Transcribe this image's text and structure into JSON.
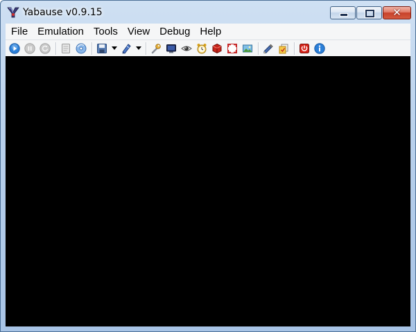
{
  "window": {
    "title": "Yabause v0.9.15",
    "app_icon": "yabause-logo-icon",
    "caption_buttons": [
      "minimize-icon",
      "maximize-icon",
      "close-icon"
    ]
  },
  "menubar": {
    "items": [
      "File",
      "Emulation",
      "Tools",
      "View",
      "Debug",
      "Help"
    ]
  },
  "toolbar": {
    "buttons": [
      {
        "icon": "play-icon",
        "enabled": true
      },
      {
        "icon": "pause-icon",
        "enabled": false
      },
      {
        "icon": "reset-icon",
        "enabled": false
      },
      {
        "icon": "load-cd-icon",
        "enabled": false
      },
      {
        "icon": "disc-icon",
        "enabled": true
      },
      {
        "icon": "save-state-icon",
        "dropdown": true
      },
      {
        "icon": "load-state-icon",
        "dropdown": true
      },
      {
        "icon": "settings-wrench-icon"
      },
      {
        "icon": "video-monitor-icon"
      },
      {
        "icon": "eye-icon"
      },
      {
        "icon": "clock-icon"
      },
      {
        "icon": "red-cube-icon"
      },
      {
        "icon": "fullscreen-icon"
      },
      {
        "icon": "screenshot-icon"
      },
      {
        "icon": "memory-card-icon"
      },
      {
        "icon": "cheats-icon"
      },
      {
        "icon": "exit-icon"
      },
      {
        "icon": "about-info-icon"
      }
    ]
  },
  "colors": {
    "display_bg": "#000000",
    "menubar_bg": "#f5f6f7",
    "window_frame": "#b9d1ec"
  }
}
